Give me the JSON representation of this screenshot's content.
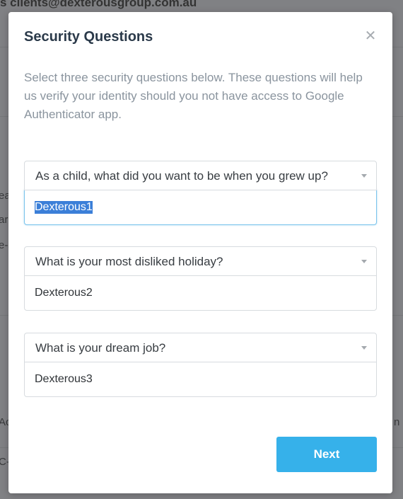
{
  "background": {
    "email_fragment": "s clients@dexterousgroup.com.au",
    "left_fragments": [
      "ea",
      "ar",
      "e-s",
      "Ac",
      "C-"
    ],
    "right_fragment": "n"
  },
  "modal": {
    "title": "Security Questions",
    "close_icon": "close-icon",
    "intro": "Select three security questions below. These questions will help us verify your identity should you not have access to Google Authenticator app.",
    "questions": [
      {
        "question": "As a child, what did you want to be when you grew up?",
        "answer": "Dexterous1",
        "focused": true,
        "answer_selected": true
      },
      {
        "question": "What is your most disliked holiday?",
        "answer": "Dexterous2",
        "focused": false
      },
      {
        "question": "What is your dream job?",
        "answer": "Dexterous3",
        "focused": false
      }
    ],
    "next_label": "Next"
  },
  "colors": {
    "accent": "#36b1ea",
    "focus_border": "#7cc4ec",
    "selection": "#3b7fd8",
    "title": "#2b3a4a",
    "muted_text": "#8a949e",
    "overlay": "#808184"
  }
}
